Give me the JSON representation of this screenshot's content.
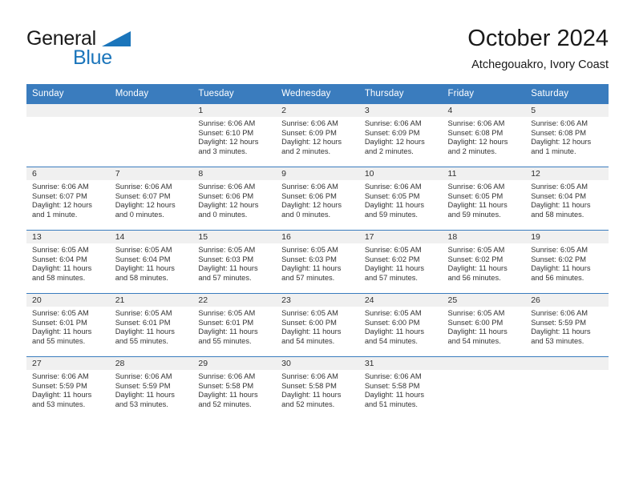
{
  "brand": {
    "name_top": "General",
    "name_bottom": "Blue",
    "triangle_color": "#1b75bb"
  },
  "header": {
    "title": "October 2024",
    "location": "Atchegouakro, Ivory Coast"
  },
  "theme": {
    "header_bg": "#3a7cbe",
    "header_text": "#ffffff",
    "daynum_band_bg": "#f0f0f0",
    "grid_line": "#3a7cbe",
    "body_text": "#333333"
  },
  "weekday_headers": [
    "Sunday",
    "Monday",
    "Tuesday",
    "Wednesday",
    "Thursday",
    "Friday",
    "Saturday"
  ],
  "labels": {
    "sunrise_prefix": "Sunrise: ",
    "sunset_prefix": "Sunset: ",
    "daylight_prefix": "Daylight: "
  },
  "weeks": [
    [
      {
        "day": "",
        "sunrise": "",
        "sunset": "",
        "daylight": "",
        "empty": true
      },
      {
        "day": "",
        "sunrise": "",
        "sunset": "",
        "daylight": "",
        "empty": true
      },
      {
        "day": "1",
        "sunrise": "Sunrise: 6:06 AM",
        "sunset": "Sunset: 6:10 PM",
        "daylight": "Daylight: 12 hours and 3 minutes."
      },
      {
        "day": "2",
        "sunrise": "Sunrise: 6:06 AM",
        "sunset": "Sunset: 6:09 PM",
        "daylight": "Daylight: 12 hours and 2 minutes."
      },
      {
        "day": "3",
        "sunrise": "Sunrise: 6:06 AM",
        "sunset": "Sunset: 6:09 PM",
        "daylight": "Daylight: 12 hours and 2 minutes."
      },
      {
        "day": "4",
        "sunrise": "Sunrise: 6:06 AM",
        "sunset": "Sunset: 6:08 PM",
        "daylight": "Daylight: 12 hours and 2 minutes."
      },
      {
        "day": "5",
        "sunrise": "Sunrise: 6:06 AM",
        "sunset": "Sunset: 6:08 PM",
        "daylight": "Daylight: 12 hours and 1 minute."
      }
    ],
    [
      {
        "day": "6",
        "sunrise": "Sunrise: 6:06 AM",
        "sunset": "Sunset: 6:07 PM",
        "daylight": "Daylight: 12 hours and 1 minute."
      },
      {
        "day": "7",
        "sunrise": "Sunrise: 6:06 AM",
        "sunset": "Sunset: 6:07 PM",
        "daylight": "Daylight: 12 hours and 0 minutes."
      },
      {
        "day": "8",
        "sunrise": "Sunrise: 6:06 AM",
        "sunset": "Sunset: 6:06 PM",
        "daylight": "Daylight: 12 hours and 0 minutes."
      },
      {
        "day": "9",
        "sunrise": "Sunrise: 6:06 AM",
        "sunset": "Sunset: 6:06 PM",
        "daylight": "Daylight: 12 hours and 0 minutes."
      },
      {
        "day": "10",
        "sunrise": "Sunrise: 6:06 AM",
        "sunset": "Sunset: 6:05 PM",
        "daylight": "Daylight: 11 hours and 59 minutes."
      },
      {
        "day": "11",
        "sunrise": "Sunrise: 6:06 AM",
        "sunset": "Sunset: 6:05 PM",
        "daylight": "Daylight: 11 hours and 59 minutes."
      },
      {
        "day": "12",
        "sunrise": "Sunrise: 6:05 AM",
        "sunset": "Sunset: 6:04 PM",
        "daylight": "Daylight: 11 hours and 58 minutes."
      }
    ],
    [
      {
        "day": "13",
        "sunrise": "Sunrise: 6:05 AM",
        "sunset": "Sunset: 6:04 PM",
        "daylight": "Daylight: 11 hours and 58 minutes."
      },
      {
        "day": "14",
        "sunrise": "Sunrise: 6:05 AM",
        "sunset": "Sunset: 6:04 PM",
        "daylight": "Daylight: 11 hours and 58 minutes."
      },
      {
        "day": "15",
        "sunrise": "Sunrise: 6:05 AM",
        "sunset": "Sunset: 6:03 PM",
        "daylight": "Daylight: 11 hours and 57 minutes."
      },
      {
        "day": "16",
        "sunrise": "Sunrise: 6:05 AM",
        "sunset": "Sunset: 6:03 PM",
        "daylight": "Daylight: 11 hours and 57 minutes."
      },
      {
        "day": "17",
        "sunrise": "Sunrise: 6:05 AM",
        "sunset": "Sunset: 6:02 PM",
        "daylight": "Daylight: 11 hours and 57 minutes."
      },
      {
        "day": "18",
        "sunrise": "Sunrise: 6:05 AM",
        "sunset": "Sunset: 6:02 PM",
        "daylight": "Daylight: 11 hours and 56 minutes."
      },
      {
        "day": "19",
        "sunrise": "Sunrise: 6:05 AM",
        "sunset": "Sunset: 6:02 PM",
        "daylight": "Daylight: 11 hours and 56 minutes."
      }
    ],
    [
      {
        "day": "20",
        "sunrise": "Sunrise: 6:05 AM",
        "sunset": "Sunset: 6:01 PM",
        "daylight": "Daylight: 11 hours and 55 minutes."
      },
      {
        "day": "21",
        "sunrise": "Sunrise: 6:05 AM",
        "sunset": "Sunset: 6:01 PM",
        "daylight": "Daylight: 11 hours and 55 minutes."
      },
      {
        "day": "22",
        "sunrise": "Sunrise: 6:05 AM",
        "sunset": "Sunset: 6:01 PM",
        "daylight": "Daylight: 11 hours and 55 minutes."
      },
      {
        "day": "23",
        "sunrise": "Sunrise: 6:05 AM",
        "sunset": "Sunset: 6:00 PM",
        "daylight": "Daylight: 11 hours and 54 minutes."
      },
      {
        "day": "24",
        "sunrise": "Sunrise: 6:05 AM",
        "sunset": "Sunset: 6:00 PM",
        "daylight": "Daylight: 11 hours and 54 minutes."
      },
      {
        "day": "25",
        "sunrise": "Sunrise: 6:05 AM",
        "sunset": "Sunset: 6:00 PM",
        "daylight": "Daylight: 11 hours and 54 minutes."
      },
      {
        "day": "26",
        "sunrise": "Sunrise: 6:06 AM",
        "sunset": "Sunset: 5:59 PM",
        "daylight": "Daylight: 11 hours and 53 minutes."
      }
    ],
    [
      {
        "day": "27",
        "sunrise": "Sunrise: 6:06 AM",
        "sunset": "Sunset: 5:59 PM",
        "daylight": "Daylight: 11 hours and 53 minutes."
      },
      {
        "day": "28",
        "sunrise": "Sunrise: 6:06 AM",
        "sunset": "Sunset: 5:59 PM",
        "daylight": "Daylight: 11 hours and 53 minutes."
      },
      {
        "day": "29",
        "sunrise": "Sunrise: 6:06 AM",
        "sunset": "Sunset: 5:58 PM",
        "daylight": "Daylight: 11 hours and 52 minutes."
      },
      {
        "day": "30",
        "sunrise": "Sunrise: 6:06 AM",
        "sunset": "Sunset: 5:58 PM",
        "daylight": "Daylight: 11 hours and 52 minutes."
      },
      {
        "day": "31",
        "sunrise": "Sunrise: 6:06 AM",
        "sunset": "Sunset: 5:58 PM",
        "daylight": "Daylight: 11 hours and 51 minutes."
      },
      {
        "day": "",
        "sunrise": "",
        "sunset": "",
        "daylight": "",
        "empty": true
      },
      {
        "day": "",
        "sunrise": "",
        "sunset": "",
        "daylight": "",
        "empty": true
      }
    ]
  ]
}
